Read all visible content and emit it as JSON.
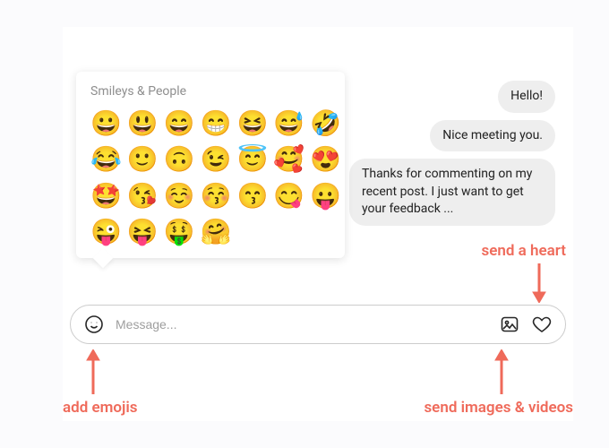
{
  "picker": {
    "title": "Smileys & People",
    "emojis": [
      "😀",
      "😃",
      "😄",
      "😁",
      "😆",
      "😅",
      "🤣",
      "😂",
      "🙂",
      "🙃",
      "😉",
      "😇",
      "🥰",
      "😍",
      "🤩",
      "😘",
      "☺️",
      "😚",
      "😙",
      "😋",
      "😛",
      "😜",
      "😝",
      "🤑",
      "🤗"
    ]
  },
  "messages": {
    "m1": "Hello!",
    "m2": "Nice meeting you.",
    "m3": "Thanks for commenting on my recent post. I just want to get your feedback ..."
  },
  "composer": {
    "placeholder": "Message..."
  },
  "annotations": {
    "heart": "send a heart",
    "emoji": "add emojis",
    "image": "send images & videos"
  }
}
